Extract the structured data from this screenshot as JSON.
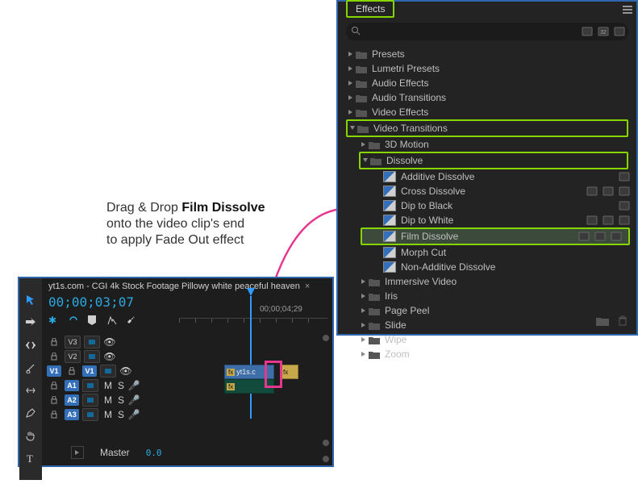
{
  "instruction": {
    "line1_pre": "Drag & Drop ",
    "line1_bold": "Film Dissolve",
    "line2": "onto the video clip's end",
    "line3": "to apply Fade Out effect"
  },
  "effects_panel": {
    "tab_label": "Effects",
    "search_placeholder": "",
    "tree": {
      "presets": "Presets",
      "lumetri": "Lumetri Presets",
      "audio_fx": "Audio Effects",
      "audio_tr": "Audio Transitions",
      "video_fx": "Video Effects",
      "video_tr": "Video Transitions",
      "three_d": "3D Motion",
      "dissolve": "Dissolve",
      "items": {
        "additive": "Additive Dissolve",
        "cross": "Cross Dissolve",
        "dip_black": "Dip to Black",
        "dip_white": "Dip to White",
        "film": "Film Dissolve",
        "morph": "Morph Cut",
        "nonadd": "Non-Additive Dissolve"
      },
      "immersive": "Immersive Video",
      "iris": "Iris",
      "pagepeel": "Page Peel",
      "slide": "Slide",
      "wipe": "Wipe",
      "zoom": "Zoom"
    }
  },
  "timeline": {
    "sequence_tab": "yt1s.com -  CGI 4k Stock Footage  Pillowy white peaceful heaven",
    "timecode": "00;00;03;07",
    "ruler_label": "00;00;04;29",
    "tracks": {
      "v3": "V3",
      "v2": "V2",
      "v1l": "V1",
      "v1r": "V1",
      "a1": "A1",
      "a2": "A2",
      "a3": "A3",
      "m": "M",
      "s": "S"
    },
    "clip_label": "yt1s.c",
    "clip_fx": "fx",
    "master_label": "Master",
    "master_value": "0.0"
  }
}
